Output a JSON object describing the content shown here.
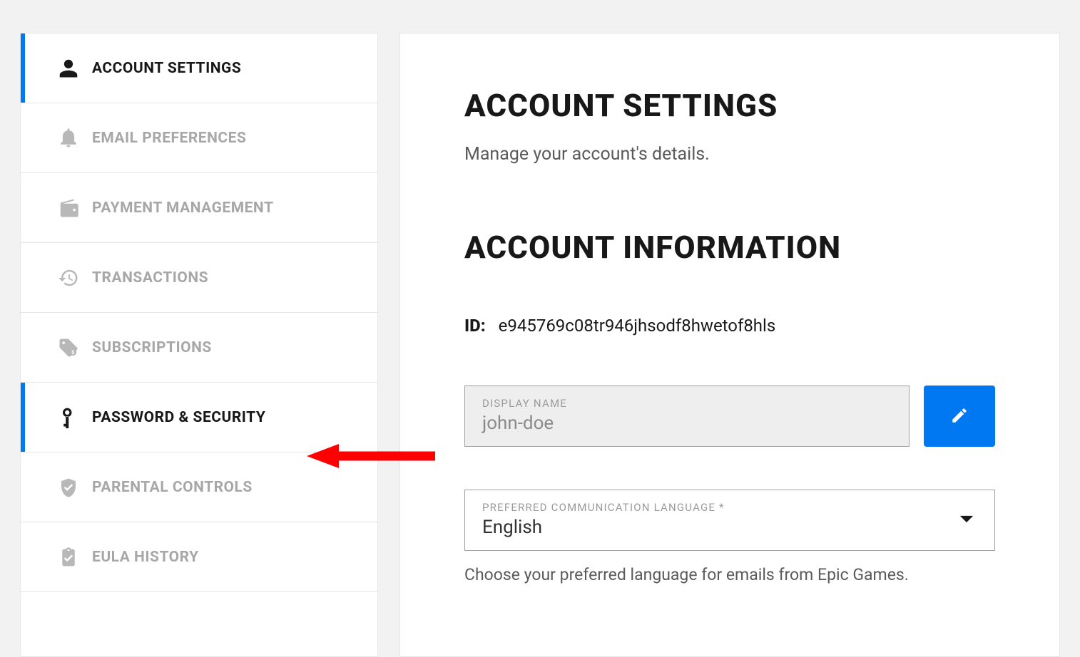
{
  "sidebar": {
    "items": [
      {
        "label": "ACCOUNT SETTINGS"
      },
      {
        "label": "EMAIL PREFERENCES"
      },
      {
        "label": "PAYMENT MANAGEMENT"
      },
      {
        "label": "TRANSACTIONS"
      },
      {
        "label": "SUBSCRIPTIONS"
      },
      {
        "label": "PASSWORD & SECURITY"
      },
      {
        "label": "PARENTAL CONTROLS"
      },
      {
        "label": "EULA HISTORY"
      }
    ]
  },
  "main": {
    "title": "ACCOUNT SETTINGS",
    "subtitle": "Manage your account's details.",
    "section_title": "ACCOUNT INFORMATION",
    "id_label": "ID:",
    "id_value": "e945769c08tr946jhsodf8hwetof8hls",
    "display_name": {
      "label": "DISPLAY NAME",
      "value": "john-doe"
    },
    "language": {
      "label": "PREFERRED COMMUNICATION LANGUAGE *",
      "value": "English",
      "helper": "Choose your preferred language for emails from Epic Games."
    }
  },
  "colors": {
    "accent": "#0078f2",
    "annotation": "#ff0000"
  }
}
